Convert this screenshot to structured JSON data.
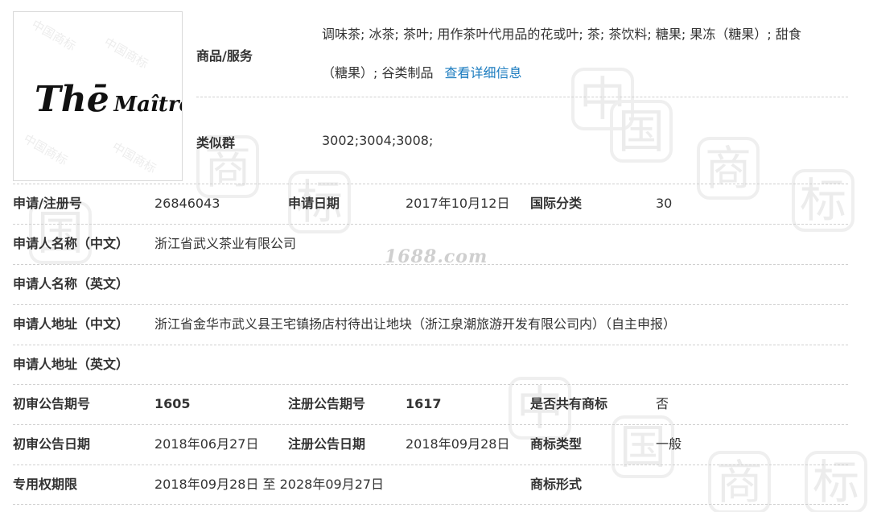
{
  "watermark_site": "1688.com",
  "logo": {
    "text_big": "Thē",
    "text_small": "Maître"
  },
  "goods": {
    "label": "商品/服务",
    "line1": "调味茶; 冰茶; 茶叶; 用作茶叶代用品的花或叶; 茶; 茶饮料; 糖果; 果冻（糖果）; 甜食",
    "line2": "（糖果）; 谷类制品",
    "detail_link": "查看详细信息"
  },
  "similar_group": {
    "label": "类似群",
    "value": "3002;3004;3008;"
  },
  "rows": {
    "reg_no_label": "申请/注册号",
    "reg_no": "26846043",
    "apply_date_label": "申请日期",
    "apply_date": "2017年10月12日",
    "intl_class_label": "国际分类",
    "intl_class": "30",
    "applicant_cn_label": "申请人名称（中文）",
    "applicant_cn": "浙江省武义茶业有限公司",
    "applicant_en_label": "申请人名称（英文）",
    "applicant_en": "",
    "address_cn_label": "申请人地址（中文）",
    "address_cn": "浙江省金华市武义县王宅镇扬店村待出让地块（浙江泉潮旅游开发有限公司内）（自主申报）",
    "address_en_label": "申请人地址（英文）",
    "address_en": "",
    "prelim_no_label": "初审公告期号",
    "prelim_no": "1605",
    "reg_pub_no_label": "注册公告期号",
    "reg_pub_no": "1617",
    "shared_label": "是否共有商标",
    "shared": "否",
    "prelim_date_label": "初审公告日期",
    "prelim_date": "2018年06月27日",
    "reg_pub_date_label": "注册公告日期",
    "reg_pub_date": "2018年09月28日",
    "mark_type_label": "商标类型",
    "mark_type": "一般",
    "exclusive_label": "专用权期限",
    "exclusive": "2018年09月28日 至 2028年09月27日",
    "mark_form_label": "商标形式",
    "mark_form": ""
  }
}
